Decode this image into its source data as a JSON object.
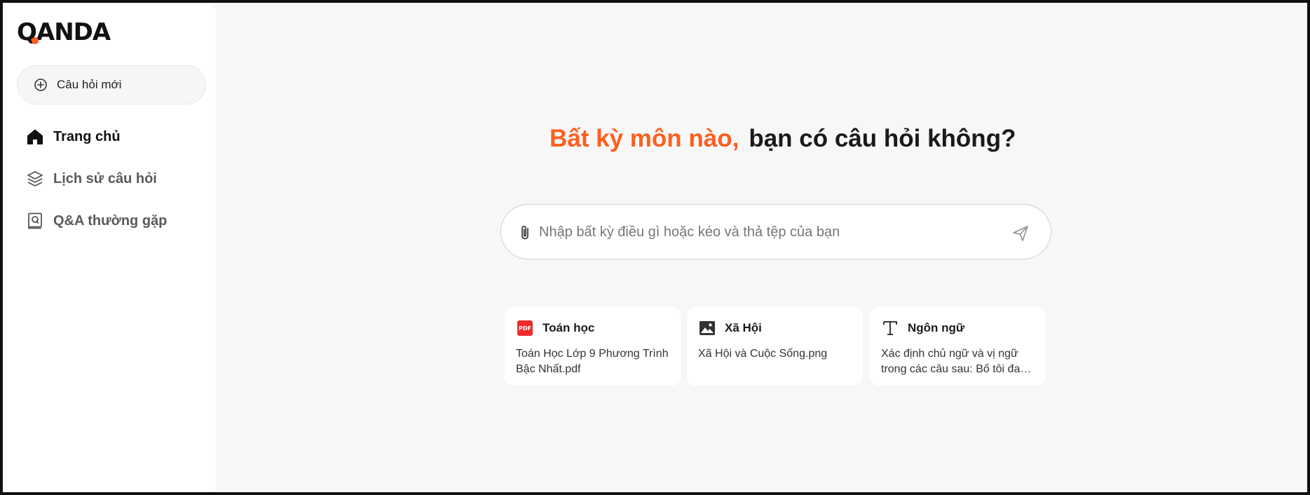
{
  "logo": {
    "q": "Q",
    "rest": "ANDA",
    "accent": "#ff5a1f"
  },
  "sidebar": {
    "new_question": {
      "label": "Câu hỏi mới",
      "icon": "plus-circle-icon"
    },
    "items": [
      {
        "label": "Trang chủ",
        "icon": "home-icon",
        "active": true
      },
      {
        "label": "Lịch sử câu hỏi",
        "icon": "layers-icon",
        "active": false
      },
      {
        "label": "Q&A thường gặp",
        "icon": "qa-book-icon",
        "active": false
      }
    ]
  },
  "main": {
    "headline": {
      "accent": "Bất kỳ môn nào,",
      "rest": "bạn có câu hỏi không?"
    },
    "search": {
      "placeholder": "Nhập bất kỳ điều gì hoặc kéo và thả tệp của bạn",
      "value": "",
      "attach_icon": "paperclip-icon",
      "send_icon": "send-icon"
    },
    "cards": [
      {
        "title": "Toán học",
        "icon": "pdf-icon",
        "icon_text": "PDF",
        "desc": "Toán Học Lớp 9 Phương Trình Bậc Nhất.pdf"
      },
      {
        "title": "Xã Hội",
        "icon": "image-icon",
        "desc": "Xã Hội và Cuộc Sống.png"
      },
      {
        "title": "Ngôn ngữ",
        "icon": "text-icon",
        "desc": "Xác định chủ ngữ và vị ngữ trong các câu sau: Bố tôi đang đọc báo."
      }
    ]
  },
  "colors": {
    "accent": "#ff5f1f",
    "background": "#f7f7f7",
    "sidebar": "#ffffff"
  }
}
